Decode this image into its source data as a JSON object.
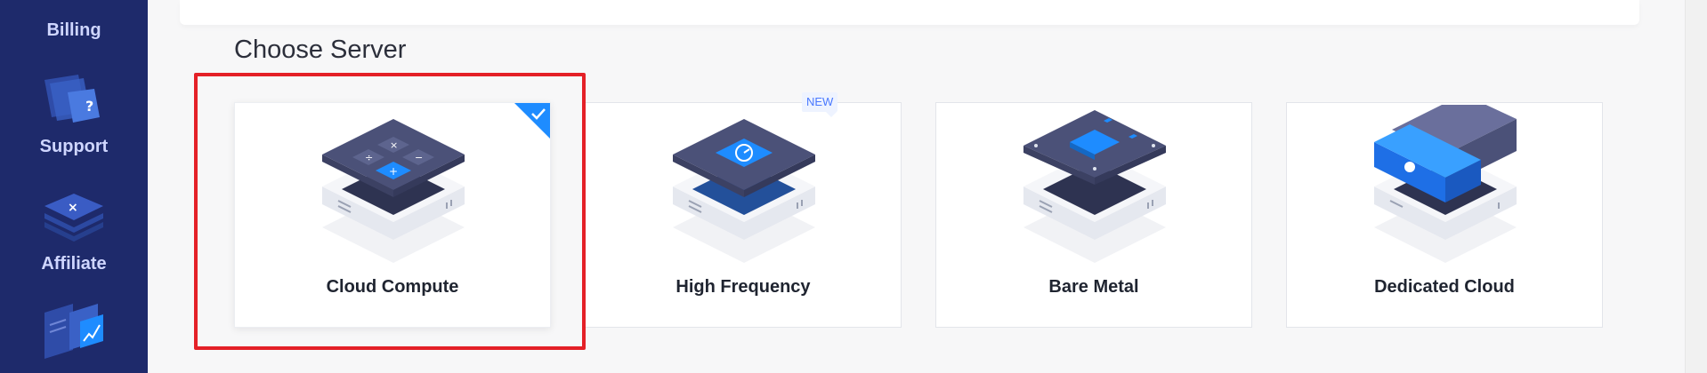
{
  "sidebar": {
    "items": [
      {
        "label": "Billing",
        "icon": "billing-icon"
      },
      {
        "label": "Support",
        "icon": "support-icon"
      },
      {
        "label": "Affiliate",
        "icon": "affiliate-icon"
      },
      {
        "label": "",
        "icon": "analytics-icon"
      }
    ]
  },
  "main": {
    "section_title": "Choose Server",
    "cards": [
      {
        "label": "Cloud Compute",
        "icon": "calculator-server-icon",
        "selected": true
      },
      {
        "label": "High Frequency",
        "icon": "speed-gauge-server-icon",
        "badge": "NEW"
      },
      {
        "label": "Bare Metal",
        "icon": "chip-server-icon"
      },
      {
        "label": "Dedicated Cloud",
        "icon": "cloud-block-server-icon"
      }
    ]
  },
  "colors": {
    "sidebar_bg": "#1e2a6b",
    "accent": "#1e8cff",
    "highlight": "#e42027"
  }
}
